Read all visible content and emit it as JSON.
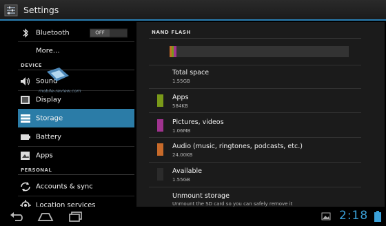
{
  "actionbar": {
    "title": "Settings"
  },
  "left": {
    "items": [
      {
        "label": "Bluetooth",
        "toggle": "OFF",
        "icon": "bluetooth-icon"
      },
      {
        "label": "More…"
      },
      {
        "label": "Sound",
        "icon": "speaker-icon"
      },
      {
        "label": "Display",
        "icon": "display-icon"
      },
      {
        "label": "Storage",
        "icon": "storage-icon",
        "selected": true
      },
      {
        "label": "Battery",
        "icon": "battery-icon"
      },
      {
        "label": "Apps",
        "icon": "apps-icon"
      },
      {
        "label": "Accounts & sync",
        "icon": "sync-icon"
      },
      {
        "label": "Location services",
        "icon": "location-icon"
      }
    ],
    "sections": {
      "device": "DEVICE",
      "personal": "PERSONAL"
    },
    "watermark": "mobile-review.com"
  },
  "storage": {
    "heading": "NAND FLASH",
    "total": {
      "title": "Total space",
      "value": "1.55GB"
    },
    "apps": {
      "title": "Apps",
      "value": "584KB",
      "color": "#7a9a19"
    },
    "pictures": {
      "title": "Pictures, videos",
      "value": "1.06MB",
      "color": "#a0338f"
    },
    "audio": {
      "title": "Audio (music, ringtones, podcasts, etc.)",
      "value": "24.00KB",
      "color": "#c86a2a"
    },
    "available": {
      "title": "Available",
      "value": "1.55GB",
      "color": "#2b2b2b"
    },
    "unmount": {
      "title": "Unmount storage",
      "subtitle": "Unmount the SD card so you can safely remove it"
    }
  },
  "navbar": {
    "clock": "2:18"
  },
  "colors": {
    "accent": "#2b7ca7",
    "clock": "#3aa0d8"
  }
}
